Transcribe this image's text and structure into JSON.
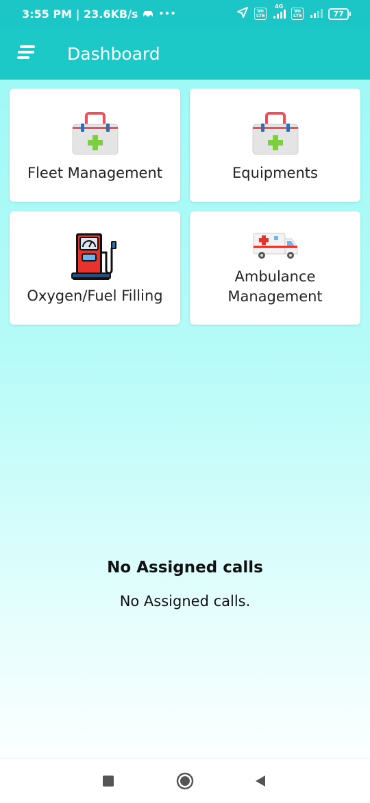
{
  "status_bar": {
    "time_speed": "3:55 PM | 23.6KB/s",
    "more": "•••",
    "volte1": "Vo LTE",
    "network_4g": "4G",
    "volte2": "Vo LTE",
    "battery": "77"
  },
  "app_bar": {
    "title": "Dashboard",
    "menu_icon": "menu-icon"
  },
  "cards": [
    {
      "label": "Fleet Management",
      "icon": "medical-kit-icon"
    },
    {
      "label": "Equipments",
      "icon": "medical-kit-icon"
    },
    {
      "label": "Oxygen/Fuel Filling",
      "icon": "fuel-pump-icon"
    },
    {
      "label_line1": "Ambulance",
      "label_line2": "Management",
      "icon": "ambulance-icon"
    }
  ],
  "empty_state": {
    "title": "No Assigned calls",
    "message": "No Assigned calls."
  },
  "nav": {
    "recents": "recents-icon",
    "home": "home-icon",
    "back": "back-icon"
  },
  "colors": {
    "primary": "#1cc9c6",
    "background_top": "#9ff9f6",
    "background_bottom": "#fbffff"
  }
}
